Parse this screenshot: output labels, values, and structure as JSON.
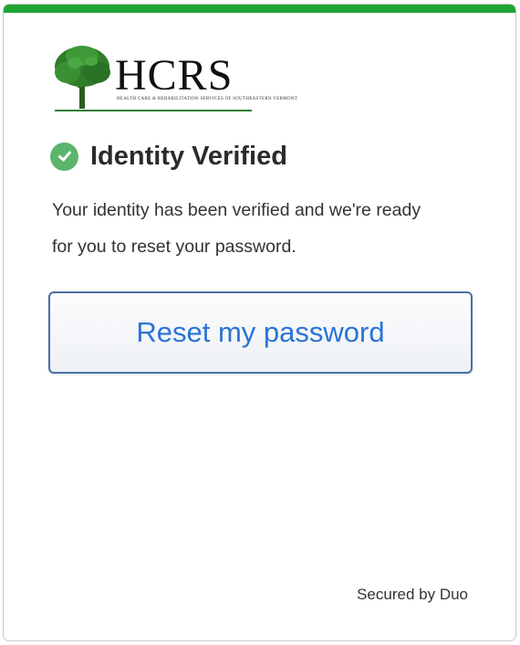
{
  "brand": {
    "logo_text": "HCRS",
    "logo_subtext": "HEALTH CARE & REHABILITATION SERVICES OF SOUTHEASTERN VERMONT",
    "logo_icon": "tree-icon",
    "top_bar_color": "#1fa535"
  },
  "status": {
    "icon": "check-circle-icon",
    "icon_color": "#5bb56c",
    "heading": "Identity Verified",
    "message_line1": "Your identity has been verified and we're ready",
    "message_line2": "for you to reset your password."
  },
  "actions": {
    "reset_label": "Reset my password",
    "reset_text_color": "#2a73d6"
  },
  "footer": {
    "secured_by": "Secured by Duo"
  }
}
